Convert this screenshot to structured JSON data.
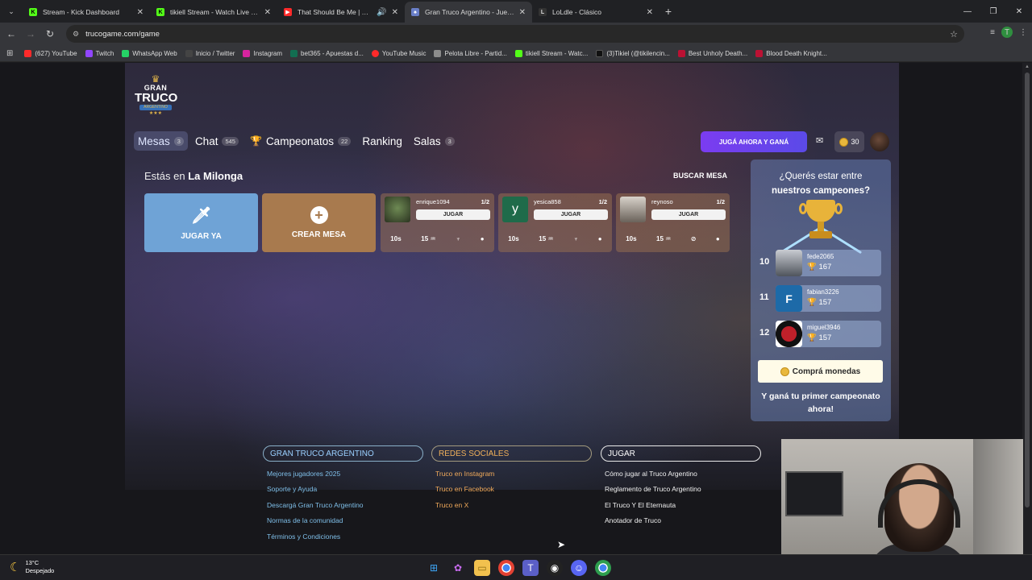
{
  "browser": {
    "tabs": [
      {
        "title": "Stream - Kick Dashboard",
        "fav": "K",
        "fav_color": "#53fc18",
        "active": false
      },
      {
        "title": "tikiell Stream - Watch Live on K",
        "fav": "K",
        "fav_color": "#53fc18",
        "active": false
      },
      {
        "title": "That Should Be Me | YouTu",
        "fav": "▶",
        "fav_color": "#ff2a2a",
        "active": false
      },
      {
        "title": "Gran Truco Argentino - Juego C",
        "fav": "♠",
        "fav_color": "#6a7fc8",
        "active": true
      },
      {
        "title": "LoLdle - Clásico",
        "fav": "L",
        "fav_color": "#333",
        "active": false
      }
    ],
    "url": "trucogame.com/game",
    "bookmarks": [
      {
        "label": "(627) YouTube",
        "color": "#ff2a2a"
      },
      {
        "label": "Twitch",
        "color": "#9146ff"
      },
      {
        "label": "WhatsApp Web",
        "color": "#25d366"
      },
      {
        "label": "Inicio / Twitter",
        "color": "#222"
      },
      {
        "label": "Instagram",
        "color": "#d6249f"
      },
      {
        "label": "bet365 - Apuestas d...",
        "color": "#126e51"
      },
      {
        "label": "YouTube Music",
        "color": "#ff2a2a"
      },
      {
        "label": "Pelota Libre - Partid...",
        "color": "#8c8c8c"
      },
      {
        "label": "tikiell Stream - Watc...",
        "color": "#53fc18"
      },
      {
        "label": "(3)Tikiel (@tikilencin...",
        "color": "#111"
      },
      {
        "label": "Best Unholy Death...",
        "color": "#b13"
      },
      {
        "label": "Blood Death Knight...",
        "color": "#b13"
      }
    ]
  },
  "logo": {
    "l1": "GRAN",
    "l2": "TRUCO",
    "l3": "ARGENTINO"
  },
  "nav": {
    "mesas": "Mesas",
    "mesas_badge": "3",
    "chat": "Chat",
    "chat_badge": "545",
    "campeonatos": "Campeonatos",
    "campeonatos_badge": "22",
    "ranking": "Ranking",
    "salas": "Salas",
    "salas_badge": "3"
  },
  "header": {
    "cta": "JUGÁ AHORA Y GANÁ",
    "coins": "30"
  },
  "room": {
    "prefix": "Estás en",
    "name": "La Milonga",
    "search": "BUSCAR MESA"
  },
  "actions": {
    "play_now": "JUGAR YA",
    "create_table": "CREAR MESA"
  },
  "tables": [
    {
      "player": "enrique1094",
      "count": "1/2",
      "button": "JUGAR",
      "time": "10s",
      "points": "15",
      "avatar_color": "#4d5a3a"
    },
    {
      "player": "yesica858",
      "count": "1/2",
      "button": "JUGAR",
      "time": "10s",
      "points": "15",
      "avatar_color": "#1f6b4a",
      "initial": "y"
    },
    {
      "player": "reynoso",
      "count": "1/2",
      "button": "JUGAR",
      "time": "10s",
      "points": "15",
      "avatar_color": "#7a6e62"
    }
  ],
  "sidebar": {
    "question_1": "¿Querés estar entre",
    "question_2": "nuestros campeones?",
    "ranking": [
      {
        "pos": "10",
        "name": "fede2065",
        "score": "167",
        "avatar_color": "#6a6f78"
      },
      {
        "pos": "11",
        "name": "fabian3226",
        "score": "157",
        "avatar_color": "#1d6aa8",
        "initial": "F"
      },
      {
        "pos": "12",
        "name": "miguel3946",
        "score": "157",
        "avatar_color": "#c0202a"
      }
    ],
    "buy": "Comprá monedas",
    "foot_1": "Y ganá tu primer campeonato",
    "foot_2": "ahora!"
  },
  "footer": {
    "col1": {
      "title": "GRAN TRUCO ARGENTINO",
      "links": [
        "Mejores jugadores 2025",
        "Soporte y Ayuda",
        "Descargá Gran Truco Argentino",
        "Normas de la comunidad",
        "Términos y Condiciones"
      ]
    },
    "col2": {
      "title": "REDES SOCIALES",
      "links": [
        "Truco en Instagram",
        "Truco en Facebook",
        "Truco en X"
      ]
    },
    "col3": {
      "title": "JUGAR",
      "links": [
        "Cómo jugar al Truco Argentino",
        "Reglamento de Truco Argentino",
        "El Truco Y El Eternauta",
        "Anotador de Truco"
      ]
    }
  },
  "taskbar": {
    "temp": "13°C",
    "weather": "Despejado"
  }
}
